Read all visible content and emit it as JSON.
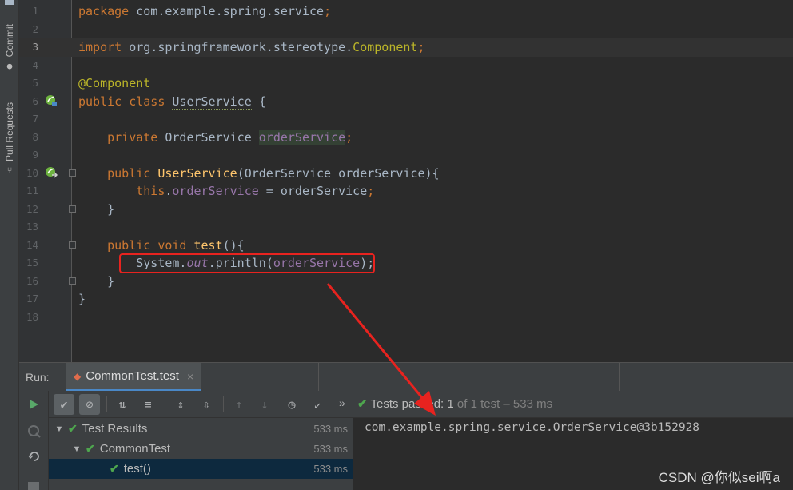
{
  "side_tabs": {
    "commit": "Commit",
    "pull_requests": "Pull Requests"
  },
  "editor": {
    "lines": [
      {
        "num": "1"
      },
      {
        "num": "2"
      },
      {
        "num": "3"
      },
      {
        "num": "4"
      },
      {
        "num": "5"
      },
      {
        "num": "6"
      },
      {
        "num": "7"
      },
      {
        "num": "8"
      },
      {
        "num": "9"
      },
      {
        "num": "10"
      },
      {
        "num": "11"
      },
      {
        "num": "12"
      },
      {
        "num": "13"
      },
      {
        "num": "14"
      },
      {
        "num": "15"
      },
      {
        "num": "16"
      },
      {
        "num": "17"
      },
      {
        "num": "18"
      }
    ],
    "tokens": {
      "package_kw": "package",
      "package_name": " com.example.spring.service",
      "semi": ";",
      "import_kw": "import",
      "import_pkg": " org.springframework.stereotype.",
      "import_cls": "Component",
      "annotation": "@Component",
      "public_kw": "public",
      "class_kw": " class ",
      "class_name": "UserService",
      "brace_open": " {",
      "private_kw": "private",
      "order_type": " OrderService ",
      "order_field": "orderService",
      "ctor_name": "UserService",
      "ctor_params": "(OrderService orderService){",
      "this_kw": "this",
      "dot": ".",
      "assign_rhs": " = orderService",
      "brace_close": "}",
      "void_kw": " void ",
      "test_name": "test",
      "test_params": "(){",
      "system": "System.",
      "out": "out",
      "println": ".println(",
      "println_close": ");"
    }
  },
  "run": {
    "label": "Run:",
    "tab_title": "CommonTest.test",
    "tab_close": "×",
    "status_passed": "Tests passed:",
    "status_count": " 1",
    "status_rest": " of 1 test – 533 ms",
    "overflow": "»",
    "tree": [
      {
        "label": "Test Results",
        "time": "533 ms"
      },
      {
        "label": "CommonTest",
        "time": "533 ms"
      },
      {
        "label": "test()",
        "time": "533 ms"
      }
    ],
    "console_output": "com.example.spring.service.OrderService@3b152928"
  },
  "watermark": "CSDN @你似sei啊a",
  "colors": {
    "annotation_box": "#e8231f",
    "pass_green": "#4ea64e",
    "selection": "#0d293e"
  }
}
